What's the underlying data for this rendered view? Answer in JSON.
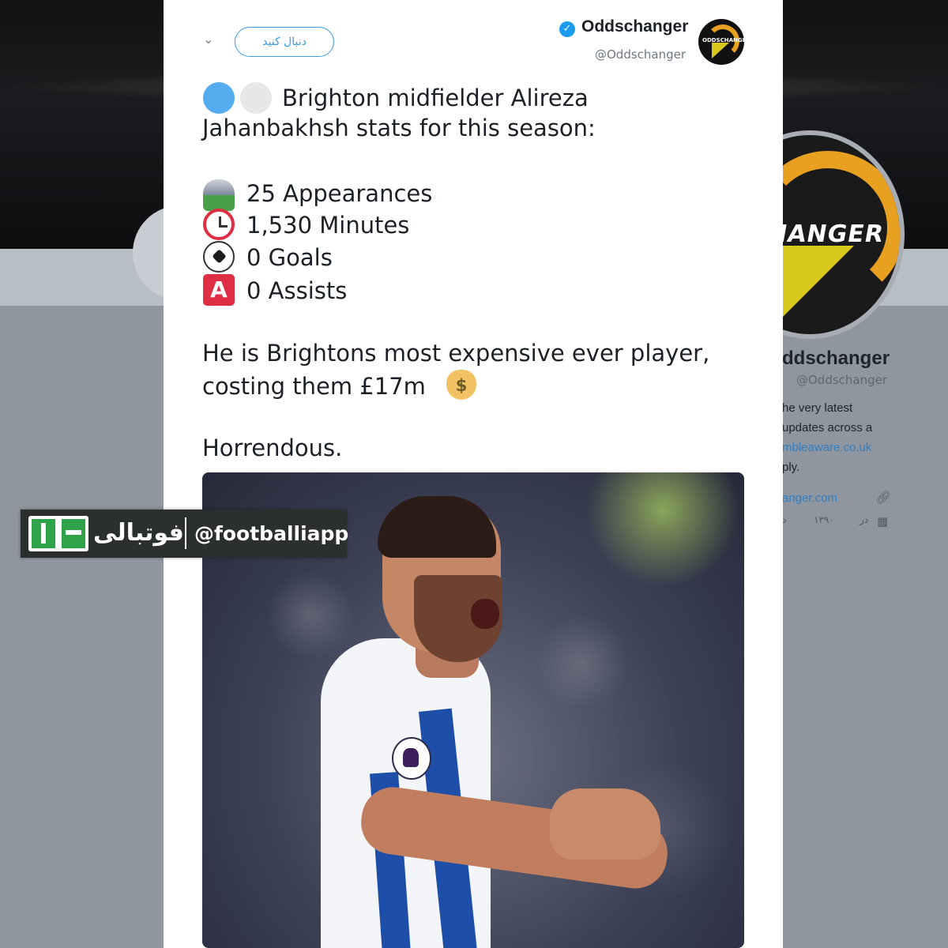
{
  "tweet": {
    "display_name": "Oddschanger",
    "handle": "@Oddschanger",
    "follow_label": "دنبال کنید",
    "caret": "⌄",
    "verified": "✓",
    "avatar_text": "ODDSCHANGER",
    "intro_line1": "Brighton midfielder Alireza",
    "intro_line2": "Jahanbakhsh stats for this season:",
    "stats": [
      {
        "icon": "stadium-icon",
        "text": "25 Appearances"
      },
      {
        "icon": "alarm-clock-icon",
        "text": "1,530 Minutes"
      },
      {
        "icon": "soccer-ball-icon",
        "text": "0 Goals"
      },
      {
        "icon": "assist-a-icon",
        "text": "0 Assists",
        "glyph": "A"
      }
    ],
    "expensive_line1": "He is Brightons most expensive ever player,",
    "expensive_line2": "costing them £17m",
    "money_glyph": "$",
    "closing": "Horrendous."
  },
  "profile_sidebar": {
    "name": "ddschanger",
    "handle": "@Oddschanger",
    "banner_text": "HANGER",
    "bio_line1": "he very latest",
    "bio_line2": "updates across a",
    "bio_link": "mbleaware.co.uk",
    "bio_line4": "ply.",
    "website": "anger.com",
    "joined_left": "د",
    "joined_mid": "۱۳۹۰",
    "joined_right": "در"
  },
  "watermark": {
    "brand_persian": "فوتبالی",
    "handle": "@footballiapp"
  },
  "colors": {
    "accent": "#1d9bf0",
    "follow_outline": "#3d9be0",
    "watermark_bg": "#2b2f2e",
    "logo_green": "#2ea34a",
    "assist_red": "#dd2e44"
  }
}
